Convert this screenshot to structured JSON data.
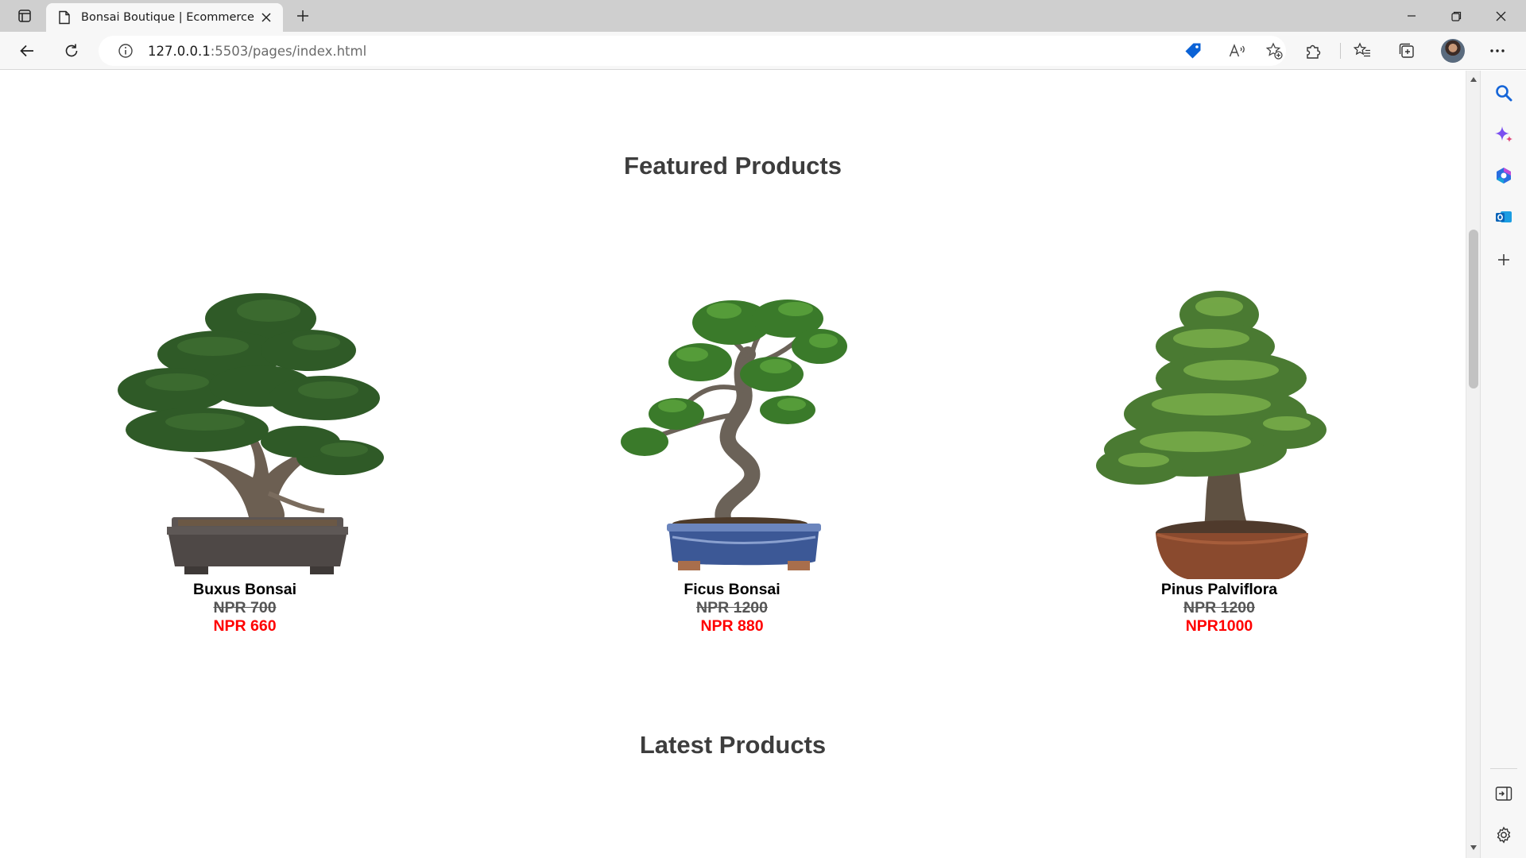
{
  "browser": {
    "tab_title": "Bonsai Boutique | Ecommerce W",
    "url_host": "127.0.0.1",
    "url_rest": ":5503/pages/index.html"
  },
  "page": {
    "featured_title": "Featured Products",
    "latest_title": "Latest Products",
    "products": [
      {
        "name": "Buxus Bonsai",
        "old_price": "NPR 700",
        "new_price": "NPR 660"
      },
      {
        "name": "Ficus Bonsai",
        "old_price": "NPR 1200",
        "new_price": "NPR 880"
      },
      {
        "name": "Pinus Palviflora",
        "old_price": "NPR 1200",
        "new_price": "NPR1000"
      }
    ]
  },
  "colors": {
    "sale_price": "#ff0000",
    "heading": "#3d3d3d",
    "accent_blue": "#0b62d6"
  },
  "icons": {
    "tab_actions": "tab-actions-icon",
    "favicon": "page-icon",
    "close_tab": "close-icon",
    "new_tab": "plus-icon",
    "back": "back-arrow-icon",
    "refresh": "refresh-icon",
    "site_info": "info-icon",
    "shopping": "tag-icon",
    "read_aloud": "read-aloud-icon",
    "favorite": "star-plus-icon",
    "extensions": "puzzle-icon",
    "favorites": "favorites-icon",
    "collections": "collections-icon",
    "more": "more-icon",
    "sidebar_search": "search-icon",
    "copilot": "copilot-icon",
    "office": "office-icon",
    "outlook": "outlook-icon",
    "add": "plus-icon",
    "hide_sidebar": "sidebar-icon",
    "settings": "gear-icon"
  }
}
